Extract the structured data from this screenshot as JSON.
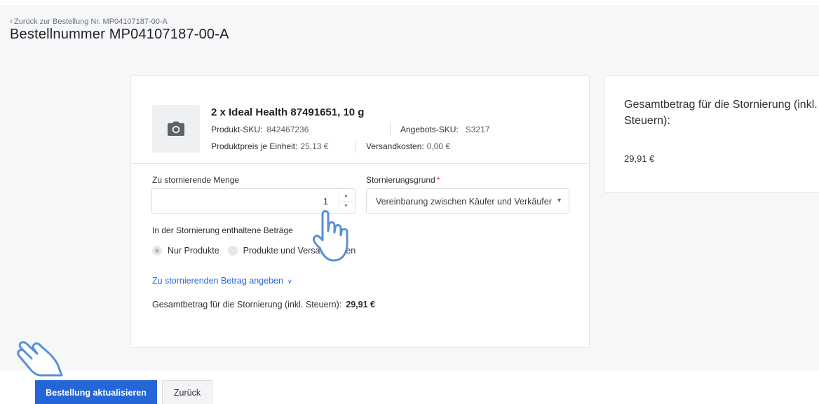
{
  "header": {
    "back_link": "Zurück zur Bestellung Nr. MP04107187-00-A",
    "title": "Bestellnummer MP04107187-00-A"
  },
  "product": {
    "title": "2 x Ideal Health 87491651, 10 g",
    "sku_label": "Produkt-SKU:",
    "sku_value": "842467236",
    "offer_sku_label": "Angebots-SKU:",
    "offer_sku_value": "S3217",
    "price_label": "Produktpreis je Einheit:",
    "price_value": "25,13 €",
    "shipping_label": "Versandkosten:",
    "shipping_value": "0,00 €",
    "image_icon": "camera-icon"
  },
  "form": {
    "quantity_label": "Zu stornierende Menge",
    "quantity_value": "1",
    "reason_label": "Stornierungsgrund",
    "reason_required_mark": "*",
    "reason_value": "Vereinbarung zwischen Käufer und Verkäufer",
    "amounts_label": "In der Stornierung enthaltene Beträge",
    "radio_options": [
      "Nur Produkte",
      "Produkte und Versandkosten"
    ],
    "radio_selected": "Nur Produkte",
    "specify_amount_link": "Zu stornierenden Betrag angeben",
    "total_label": "Gesamtbetrag für die Stornierung (inkl. Steuern):",
    "total_value": "29,91 €"
  },
  "summary": {
    "title": "Gesamtbetrag für die Stornierung (inkl. Steuern):",
    "value": "29,91 €"
  },
  "footer": {
    "primary_button": "Bestellung aktualisieren",
    "secondary_button": "Zurück"
  },
  "colors": {
    "accent": "#2466d8",
    "link": "#2b67d6",
    "required": "#d9262c",
    "pointer": "#5b8fd6"
  }
}
